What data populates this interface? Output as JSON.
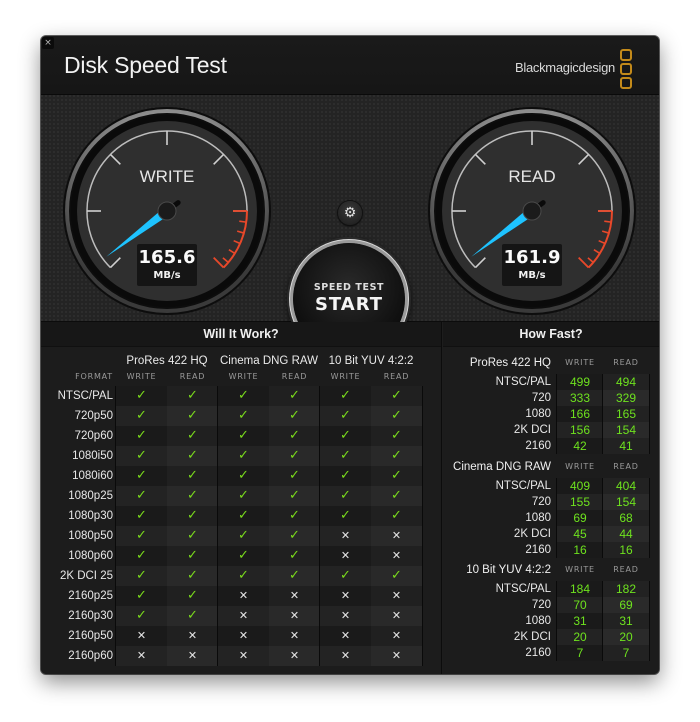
{
  "window": {
    "close_label": "×",
    "title": "Disk Speed Test",
    "brand": "Blackmagicdesign",
    "brand_logo_icon": "three-rounded-squares",
    "brand_color": "#c38a1a"
  },
  "gauges": {
    "write": {
      "label": "WRITE",
      "value": "165.6",
      "unit": "MB/s",
      "needle_color": "#1ec3ff"
    },
    "read": {
      "label": "READ",
      "value": "161.9",
      "unit": "MB/s",
      "needle_color": "#1ec3ff"
    },
    "redline_color": "#e8482a"
  },
  "controls": {
    "settings_icon": "⚙",
    "start_top": "SPEED TEST",
    "start_main": "START"
  },
  "will_it_work": {
    "title": "Will It Work?",
    "format_header": "FORMAT",
    "codecs": [
      "ProRes 422 HQ",
      "Cinema DNG RAW",
      "10 Bit YUV 4:2:2"
    ],
    "subheaders": [
      "WRITE",
      "READ"
    ],
    "check_symbol": "✓",
    "cross_symbol": "✕",
    "check_color": "#7bdc1c",
    "rows": [
      {
        "format": "NTSC/PAL",
        "values": [
          true,
          true,
          true,
          true,
          true,
          true
        ]
      },
      {
        "format": "720p50",
        "values": [
          true,
          true,
          true,
          true,
          true,
          true
        ]
      },
      {
        "format": "720p60",
        "values": [
          true,
          true,
          true,
          true,
          true,
          true
        ]
      },
      {
        "format": "1080i50",
        "values": [
          true,
          true,
          true,
          true,
          true,
          true
        ]
      },
      {
        "format": "1080i60",
        "values": [
          true,
          true,
          true,
          true,
          true,
          true
        ]
      },
      {
        "format": "1080p25",
        "values": [
          true,
          true,
          true,
          true,
          true,
          true
        ]
      },
      {
        "format": "1080p30",
        "values": [
          true,
          true,
          true,
          true,
          true,
          true
        ]
      },
      {
        "format": "1080p50",
        "values": [
          true,
          true,
          true,
          true,
          false,
          false
        ]
      },
      {
        "format": "1080p60",
        "values": [
          true,
          true,
          true,
          true,
          false,
          false
        ]
      },
      {
        "format": "2K DCI 25",
        "values": [
          true,
          true,
          true,
          true,
          true,
          true
        ]
      },
      {
        "format": "2160p25",
        "values": [
          true,
          true,
          false,
          false,
          false,
          false
        ]
      },
      {
        "format": "2160p30",
        "values": [
          true,
          true,
          false,
          false,
          false,
          false
        ]
      },
      {
        "format": "2160p50",
        "values": [
          false,
          false,
          false,
          false,
          false,
          false
        ]
      },
      {
        "format": "2160p60",
        "values": [
          false,
          false,
          false,
          false,
          false,
          false
        ]
      }
    ]
  },
  "how_fast": {
    "title": "How Fast?",
    "subheaders": [
      "WRITE",
      "READ"
    ],
    "value_color": "#6ee21e",
    "sections": [
      {
        "codec": "ProRes 422 HQ",
        "rows": [
          {
            "label": "NTSC/PAL",
            "write": "499",
            "read": "494"
          },
          {
            "label": "720",
            "write": "333",
            "read": "329"
          },
          {
            "label": "1080",
            "write": "166",
            "read": "165"
          },
          {
            "label": "2K DCI",
            "write": "156",
            "read": "154"
          },
          {
            "label": "2160",
            "write": "42",
            "read": "41"
          }
        ]
      },
      {
        "codec": "Cinema DNG RAW",
        "rows": [
          {
            "label": "NTSC/PAL",
            "write": "409",
            "read": "404"
          },
          {
            "label": "720",
            "write": "155",
            "read": "154"
          },
          {
            "label": "1080",
            "write": "69",
            "read": "68"
          },
          {
            "label": "2K DCI",
            "write": "45",
            "read": "44"
          },
          {
            "label": "2160",
            "write": "16",
            "read": "16"
          }
        ]
      },
      {
        "codec": "10 Bit YUV 4:2:2",
        "rows": [
          {
            "label": "NTSC/PAL",
            "write": "184",
            "read": "182"
          },
          {
            "label": "720",
            "write": "70",
            "read": "69"
          },
          {
            "label": "1080",
            "write": "31",
            "read": "31"
          },
          {
            "label": "2K DCI",
            "write": "20",
            "read": "20"
          },
          {
            "label": "2160",
            "write": "7",
            "read": "7"
          }
        ]
      }
    ]
  }
}
